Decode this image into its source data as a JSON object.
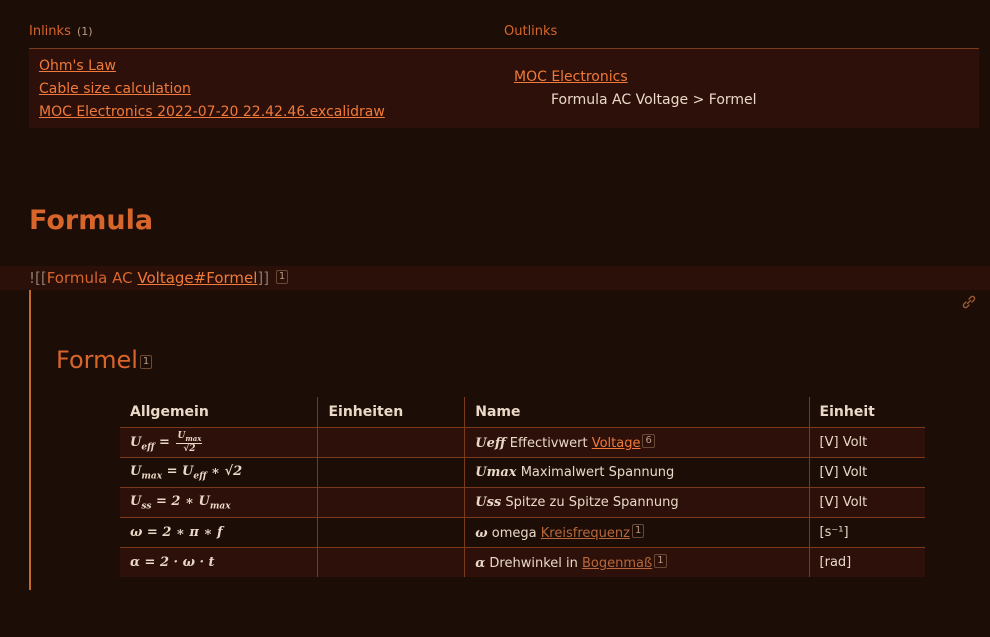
{
  "inlinks": {
    "title": "Inlinks",
    "count": "(1)",
    "items": [
      "Ohm's Law",
      "Cable size calculation",
      "MOC Electronics 2022-07-20 22.42.46.excalidraw"
    ]
  },
  "outlinks": {
    "title": "Outlinks",
    "link": "MOC Electronics",
    "sub": "Formula AC Voltage > Formel"
  },
  "heading": "Formula",
  "embed": {
    "prefix": "![[",
    "part1": "Formula AC ",
    "part2": "Voltage#Formel",
    "suffix": "]]",
    "count": "1"
  },
  "embed_block": {
    "heading": "Formel",
    "heading_count": "1",
    "columns": [
      "Allgemein",
      "Einheiten",
      "Name",
      "Einheit"
    ],
    "rows": [
      {
        "formula": "U_eff = U_max / √2",
        "name_sym": "Ueff",
        "name_text": "Effectivwert",
        "name_link": "Voltage",
        "name_count": "6",
        "unit": "[V] Volt"
      },
      {
        "formula": "U_max = U_eff * √2",
        "name_sym": "Umax",
        "name_text": "Maximalwert Spannung",
        "name_link": "",
        "name_count": "",
        "unit": "[V] Volt"
      },
      {
        "formula": "U_ss = 2 * U_max",
        "name_sym": "Uss",
        "name_text": "Spitze zu Spitze Spannung",
        "name_link": "",
        "name_count": "",
        "unit": "[V] Volt"
      },
      {
        "formula": "ω = 2 * π * f",
        "name_sym": "ω",
        "name_text": "omega",
        "name_link": "Kreisfrequenz",
        "name_count": "1",
        "unit": "[s⁻¹]"
      },
      {
        "formula": "α = 2 · ω · t",
        "name_sym": "α",
        "name_text": "Drehwinkel in",
        "name_link": "Bogenmaß",
        "name_count": "1",
        "unit": "[rad]"
      }
    ]
  },
  "colors": {
    "accent": "#d8662c",
    "link": "#f07a3a",
    "background": "#1c0d06"
  }
}
